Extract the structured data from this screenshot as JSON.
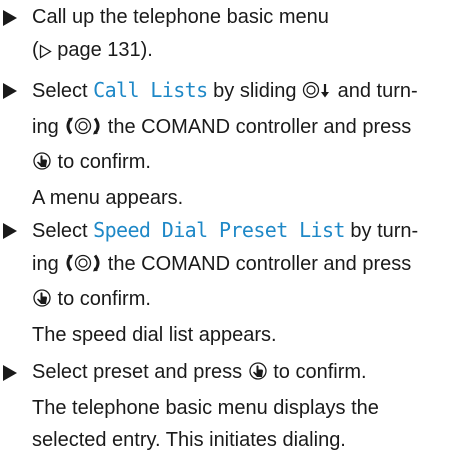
{
  "steps": [
    {
      "line1": "Call up the telephone basic menu",
      "line2_tail": " page 131)."
    },
    {
      "a": "Select ",
      "menu": "Call Lists",
      "b": " by sliding ",
      "c": " and turn-",
      "d": "ing ",
      "e": " the COMAND controller and press",
      "f": " to confirm.",
      "result": "A menu appears."
    },
    {
      "a": "Select ",
      "menu": "Speed Dial Preset List",
      "b": " by turn-",
      "d": "ing ",
      "e": " the COMAND controller and press",
      "f": " to confirm.",
      "result": "The speed dial list appears."
    },
    {
      "a": "Select preset and press ",
      "f": " to confirm.",
      "result1": "The telephone basic menu displays the",
      "result2": "selected entry. This initiates dialing."
    }
  ],
  "icons": {
    "page_ref": "page-reference-icon",
    "slide_down": "controller-slide-down-icon",
    "turn": "controller-turn-icon",
    "press": "controller-press-icon"
  },
  "colors": {
    "menu_text": "#1e88c7",
    "text": "#1a1a1a"
  }
}
